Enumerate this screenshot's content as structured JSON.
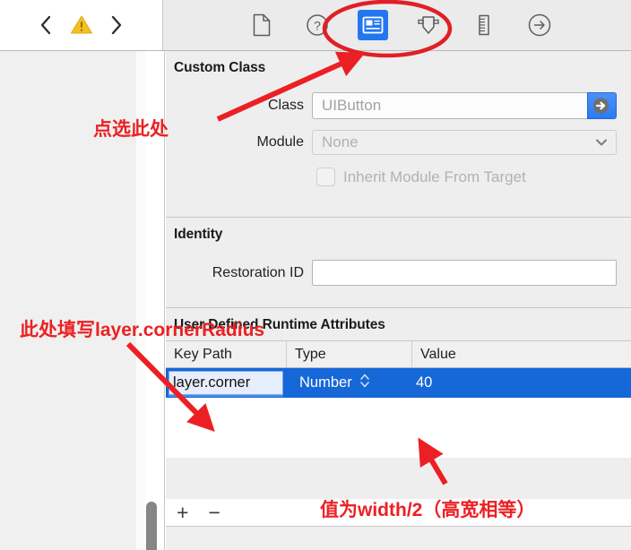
{
  "toolbar": {
    "nav_back_icon": "chevron-left-icon",
    "warning_icon": "warning-triangle-icon",
    "nav_forward_icon": "chevron-right-icon",
    "inspectors": [
      {
        "name": "file-inspector",
        "icon": "document-icon",
        "selected": false
      },
      {
        "name": "quick-help-inspector",
        "icon": "question-mark-circle-icon",
        "selected": false
      },
      {
        "name": "identity-inspector",
        "icon": "identity-card-icon",
        "selected": true
      },
      {
        "name": "attributes-inspector",
        "icon": "attributes-slider-icon",
        "selected": false
      },
      {
        "name": "size-inspector",
        "icon": "ruler-icon",
        "selected": false
      },
      {
        "name": "connections-inspector",
        "icon": "arrow-right-circle-icon",
        "selected": false
      }
    ]
  },
  "custom_class": {
    "title": "Custom Class",
    "class_label": "Class",
    "class_value": "UIButton",
    "class_jump_icon": "jump-to-definition-icon",
    "class_dropdown_icon": "chevron-down-icon",
    "module_label": "Module",
    "module_value": "None",
    "module_dropdown_icon": "chevron-down-icon",
    "inherit_label": "Inherit Module From Target",
    "inherit_checked": false
  },
  "identity": {
    "title": "Identity",
    "restoration_label": "Restoration ID",
    "restoration_value": ""
  },
  "runtime_attributes": {
    "title": "User Defined Runtime Attributes",
    "columns": [
      "Key Path",
      "Type",
      "Value"
    ],
    "rows": [
      {
        "key_path": "layer.corner",
        "type": "Number",
        "type_stepper_icon": "up-down-stepper-icon",
        "value": "40",
        "selected": true
      }
    ],
    "add_label": "+",
    "remove_label": "−"
  },
  "annotations": {
    "click_here": "点选此处",
    "fill_keypath": "此处填写layer.cornerRadius",
    "value_note": "值为width/2（高宽相等）",
    "highlight_color": "#ec2024"
  },
  "colors": {
    "selection_blue": "#1667d8",
    "accent_blue": "#2476f0",
    "annotation_red": "#ec2024",
    "panel_bg": "#eeeeee",
    "toolbar_bg": "#ebebeb"
  }
}
